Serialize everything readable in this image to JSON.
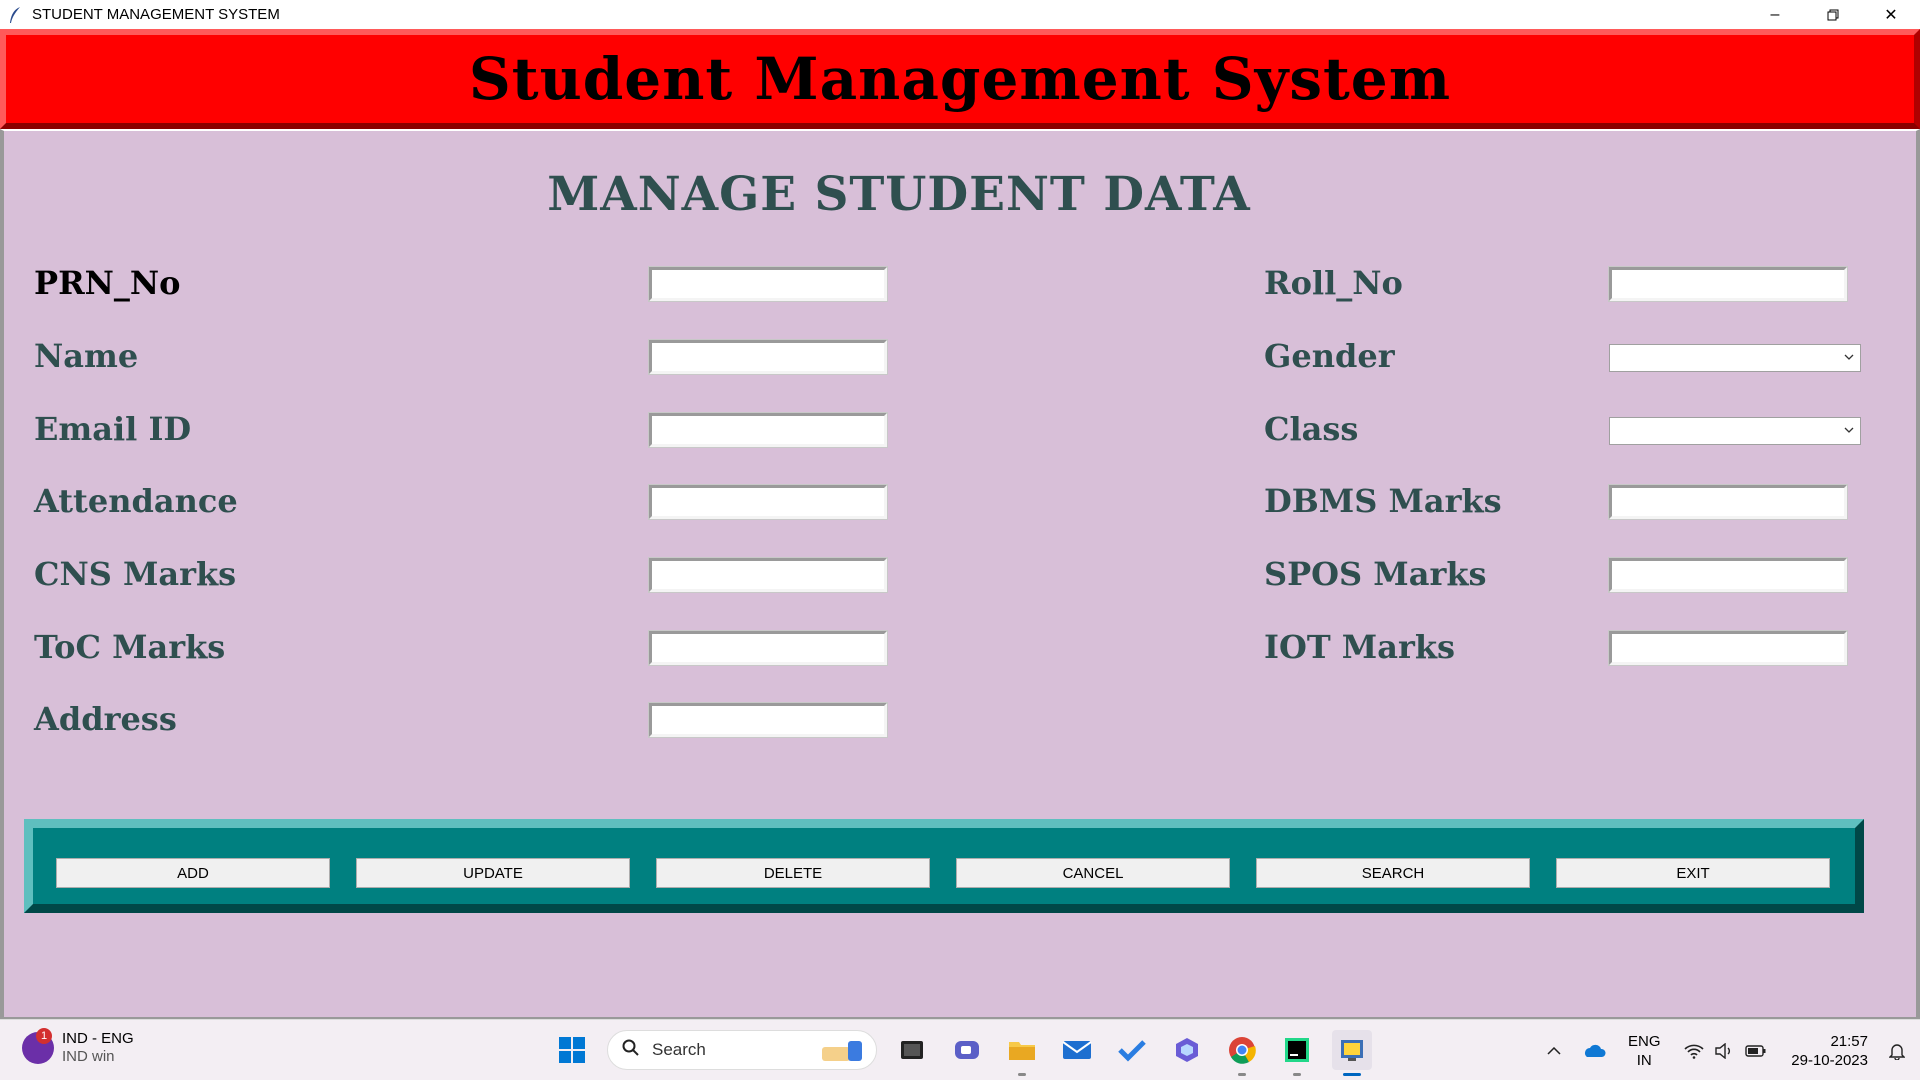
{
  "window": {
    "title": "STUDENT MANAGEMENT SYSTEM",
    "icon": "feather-icon",
    "controls": [
      "minimize-icon",
      "restore-icon",
      "close-icon"
    ]
  },
  "header": {
    "title": "Student Management System",
    "bg_color": "#ff0000"
  },
  "panel": {
    "title": "MANAGE STUDENT DATA",
    "bg_color": "#d8bfd8",
    "label_color": "#2f4f4f"
  },
  "form": {
    "prn_label": "PRN_No",
    "name_label": "Name",
    "email_label": "Email ID",
    "attendance_label": "Attendance",
    "cns_label": "CNS Marks",
    "toc_label": "ToC Marks",
    "address_label": "Address",
    "roll_label": "Roll_No",
    "gender_label": "Gender",
    "class_label": "Class",
    "dbms_label": "DBMS Marks",
    "spos_label": "SPOS Marks",
    "iot_label": "IOT Marks",
    "values": {
      "prn": "",
      "name": "",
      "email": "",
      "attendance": "",
      "cns": "",
      "toc": "",
      "address": "",
      "roll": "",
      "gender": "",
      "class": "",
      "dbms": "",
      "spos": "",
      "iot": ""
    }
  },
  "buttons": {
    "add": "ADD",
    "update": "UPDATE",
    "delete": "DELETE",
    "cancel": "CANCEL",
    "search": "SEARCH",
    "exit": "EXIT",
    "frame_color": "#008080"
  },
  "taskbar": {
    "badge_count": "1",
    "lang_line1": "IND - ENG",
    "lang_line2": "IND win",
    "search_placeholder": "Search",
    "apps": [
      "windows-start-icon",
      "search-icon",
      "task-view-icon",
      "teams-chat-icon",
      "file-explorer-icon",
      "mail-icon",
      "todo-icon",
      "copilot-icon",
      "chrome-icon",
      "pycharm-icon",
      "python-app-icon"
    ],
    "tray": [
      "chevron-up-icon",
      "onedrive-icon",
      "wifi-icon",
      "volume-icon",
      "battery-icon",
      "notification-bell-icon"
    ],
    "input_lang": "ENG",
    "input_region": "IN",
    "time": "21:57",
    "date": "29-10-2023"
  }
}
